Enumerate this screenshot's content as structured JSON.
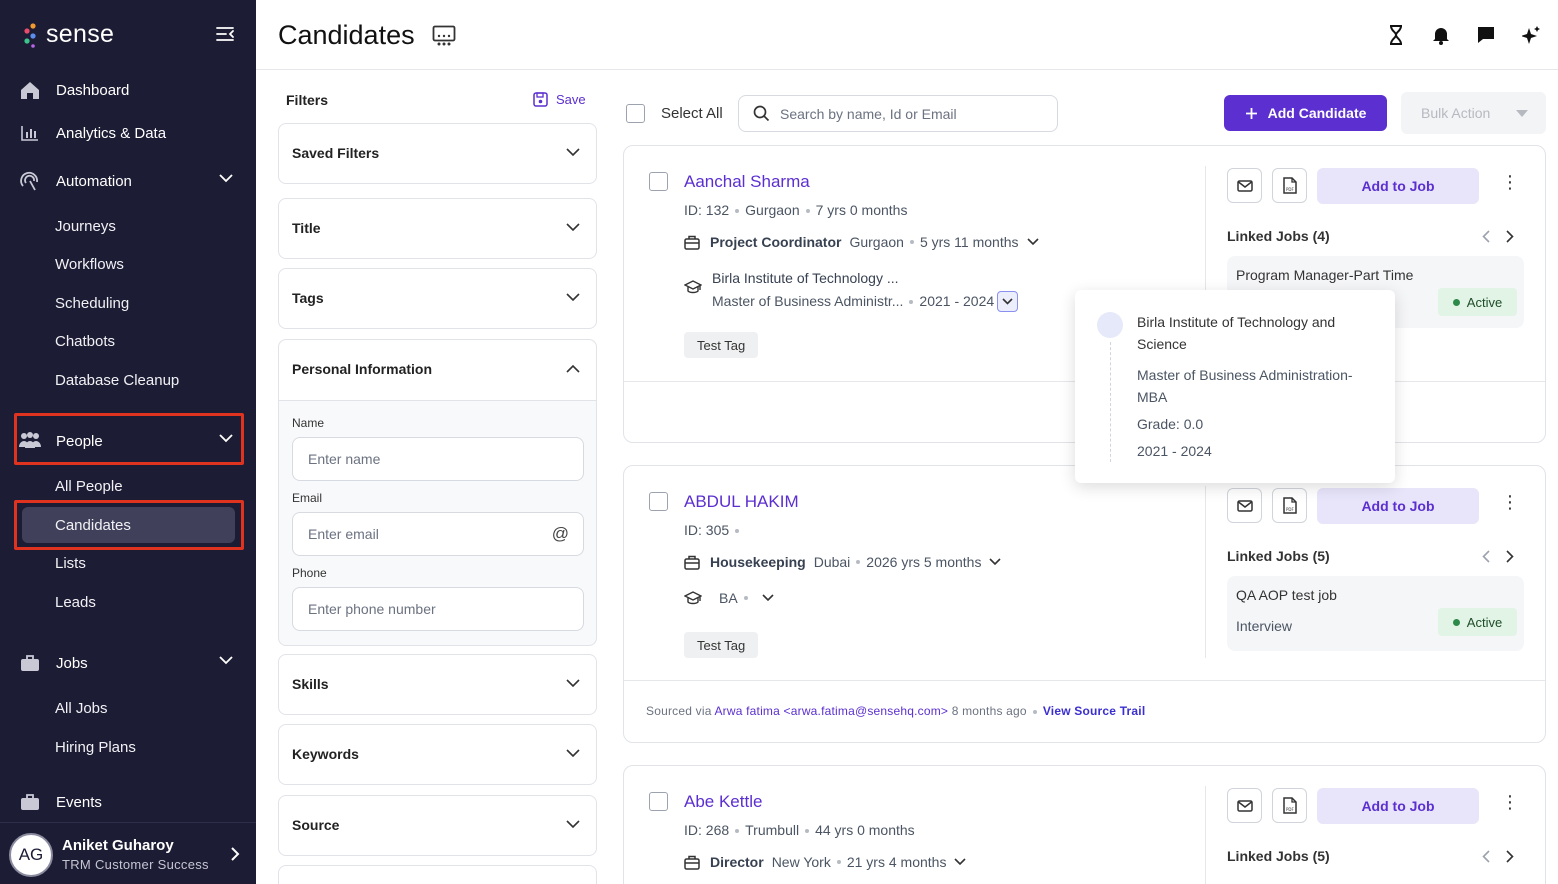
{
  "brand": {
    "name": "sense"
  },
  "sidebar": {
    "items": [
      {
        "label": "Dashboard"
      },
      {
        "label": "Analytics & Data"
      },
      {
        "label": "Automation"
      },
      {
        "label": "Journeys"
      },
      {
        "label": "Workflows"
      },
      {
        "label": "Scheduling"
      },
      {
        "label": "Chatbots"
      },
      {
        "label": "Database Cleanup"
      },
      {
        "label": "People"
      },
      {
        "label": "All People"
      },
      {
        "label": "Candidates"
      },
      {
        "label": "Lists"
      },
      {
        "label": "Leads"
      },
      {
        "label": "Jobs"
      },
      {
        "label": "All Jobs"
      },
      {
        "label": "Hiring Plans"
      },
      {
        "label": "Events"
      }
    ],
    "user": {
      "initials": "AG",
      "name": "Aniket Guharoy",
      "role": "TRM Customer Success"
    }
  },
  "header": {
    "title": "Candidates"
  },
  "filters": {
    "title": "Filters",
    "save_label": "Save",
    "sections": [
      "Saved Filters",
      "Title",
      "Tags",
      "Personal Information",
      "Skills",
      "Keywords",
      "Source"
    ],
    "personal": {
      "name_label": "Name",
      "name_placeholder": "Enter name",
      "email_label": "Email",
      "email_placeholder": "Enter email",
      "email_icon": "@",
      "phone_label": "Phone",
      "phone_placeholder": "Enter phone number"
    }
  },
  "toolbar": {
    "select_all": "Select All",
    "search_placeholder": "Search by name, Id or Email",
    "add_candidate": "Add Candidate",
    "bulk_action": "Bulk Action"
  },
  "candidates": [
    {
      "name": "Aanchal Sharma",
      "id": "ID: 132",
      "location": "Gurgaon",
      "experience": "7 yrs 0 months",
      "job_title": "Project Coordinator",
      "job_location": "Gurgaon",
      "job_duration": "5 yrs 11 months",
      "edu_school": "Birla Institute of Technology ...",
      "edu_degree": "Master of Business Administr...",
      "edu_years": "2021 - 2024",
      "tag": "Test Tag",
      "add_to_job": "Add to Job",
      "linked_jobs": "Linked Jobs (4)",
      "job_name": "Program Manager-Part Time",
      "job_status": "Active"
    },
    {
      "name": "ABDUL HAKIM",
      "id": "ID: 305",
      "job_title": "Housekeeping",
      "job_location": "Dubai",
      "job_duration": "2026 yrs 5 months",
      "edu_degree": "BA",
      "tag": "Test Tag",
      "add_to_job": "Add to Job",
      "linked_jobs": "Linked Jobs (5)",
      "job_name": "QA AOP test job",
      "job_stage": "Interview",
      "job_status": "Active",
      "source_prefix": "Sourced via",
      "source_person": "Arwa fatima <arwa.fatima@sensehq.com>",
      "source_time": "8 months ago",
      "source_trail": "View Source Trail"
    },
    {
      "name": "Abe Kettle",
      "id": "ID: 268",
      "location": "Trumbull",
      "experience": "44 yrs 0 months",
      "job_title": "Director",
      "job_location": "New York",
      "job_duration": "21 yrs 4 months",
      "add_to_job": "Add to Job",
      "linked_jobs": "Linked Jobs (5)"
    }
  ],
  "education_popover": {
    "school": "Birla Institute of Technology and Science",
    "degree": "Master of Business Administration-MBA",
    "grade": "Grade: 0.0",
    "years": "2021 - 2024"
  }
}
